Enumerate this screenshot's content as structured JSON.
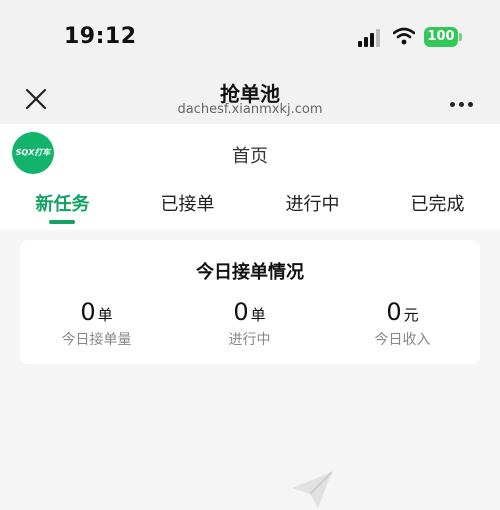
{
  "status_bar": {
    "time": "19:12",
    "battery": "100",
    "icons": [
      "signal-icon",
      "wifi-icon",
      "battery-icon"
    ]
  },
  "nav": {
    "title": "抢单池",
    "domain": "dachesf.xianmxkj.com",
    "icons": [
      "close-icon",
      "more-icon"
    ]
  },
  "page": {
    "logo_text": "SQX打车",
    "title": "首页"
  },
  "tabs": [
    {
      "label": "新任务",
      "active": true
    },
    {
      "label": "已接单",
      "active": false
    },
    {
      "label": "进行中",
      "active": false
    },
    {
      "label": "已完成",
      "active": false
    }
  ],
  "summary": {
    "title": "今日接单情况",
    "stats": [
      {
        "value": "0",
        "unit": "单",
        "label": "今日接单量"
      },
      {
        "value": "0",
        "unit": "单",
        "label": "进行中"
      },
      {
        "value": "0",
        "unit": "元",
        "label": "今日收入"
      }
    ]
  },
  "colors": {
    "accent": "#12a263",
    "logo_bg": "#12b36b",
    "battery": "#34c759"
  },
  "empty_state": {
    "icon": "paper-plane-icon"
  }
}
